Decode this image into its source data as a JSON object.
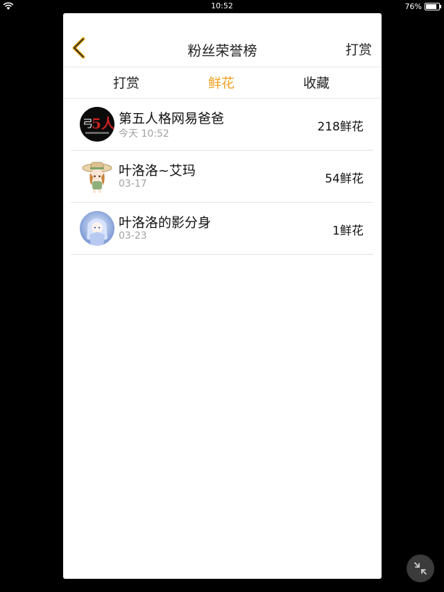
{
  "status_bar": {
    "time": "10:52",
    "battery_percent": "76%",
    "battery_level": 0.76
  },
  "header": {
    "title": "粉丝荣誉榜",
    "right_action": "打赏",
    "back_icon": "chevron-left-icon",
    "accent_color": "#f0a01f"
  },
  "tabs": [
    {
      "label": "打赏",
      "active": false
    },
    {
      "label": "鲜花",
      "active": true
    },
    {
      "label": "收藏",
      "active": false
    }
  ],
  "rows": [
    {
      "name": "第五人格网易爸爸",
      "date": "今天 10:52",
      "amount": "218鲜花",
      "avatar_text": "5人"
    },
    {
      "name": "叶洛洛~艾玛",
      "date": "03-17",
      "amount": "54鲜花"
    },
    {
      "name": "叶洛洛的影分身",
      "date": "03-23",
      "amount": "1鲜花"
    }
  ],
  "floating_button": {
    "icon": "collapse-arrows-icon"
  }
}
